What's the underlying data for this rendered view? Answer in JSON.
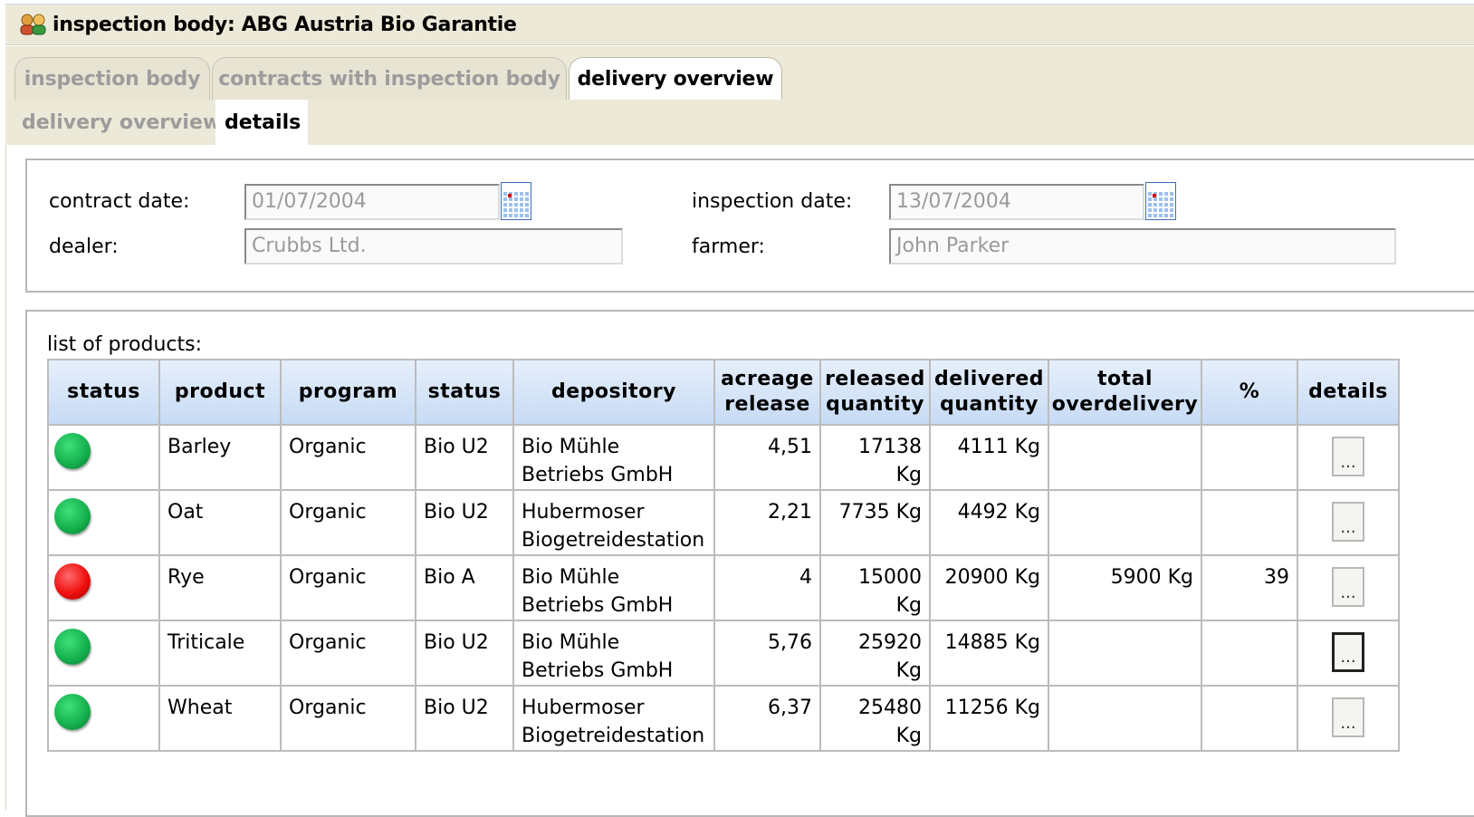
{
  "window": {
    "title": "inspection body: ABG Austria Bio Garantie",
    "icon": "users-icon"
  },
  "tabs": [
    {
      "label": "inspection body",
      "active": false
    },
    {
      "label": "contracts with inspection body",
      "active": false
    },
    {
      "label": "delivery overview",
      "active": true
    }
  ],
  "subtabs": [
    {
      "label": "delivery overview",
      "active": false
    },
    {
      "label": "details",
      "active": true
    }
  ],
  "form": {
    "contract_date_label": "contract date:",
    "contract_date_value": "01/07/2004",
    "inspection_date_label": "inspection date:",
    "inspection_date_value": "13/07/2004",
    "dealer_label": "dealer:",
    "dealer_value": "Crubbs Ltd.",
    "farmer_label": "farmer:",
    "farmer_value": "John Parker"
  },
  "products": {
    "caption": "list of products:",
    "headers": {
      "status": "status",
      "product": "product",
      "program": "program",
      "status2": "status",
      "depository": "depository",
      "acreage_line1": "acreage",
      "acreage_line2": "release",
      "released_line1": "released",
      "released_line2": "quantity",
      "delivered_line1": "delivered",
      "delivered_line2": "quantity",
      "overdelivery_line1": "total",
      "overdelivery_line2": "overdelivery",
      "percent": "%",
      "details": "details"
    },
    "rows": [
      {
        "status_color": "green",
        "product": "Barley",
        "program": "Organic",
        "status": "Bio U2",
        "depository_line1": "Bio Mühle",
        "depository_line2": "Betriebs GmbH",
        "acreage": "4,51",
        "released": "17138 Kg",
        "delivered": "4111 Kg",
        "overdelivery": "",
        "percent": "",
        "details_label": "...",
        "details_focused": false
      },
      {
        "status_color": "green",
        "product": "Oat",
        "program": "Organic",
        "status": "Bio U2",
        "depository_line1": "Hubermoser",
        "depository_line2": "Biogetreidestation",
        "acreage": "2,21",
        "released": "7735 Kg",
        "delivered": "4492 Kg",
        "overdelivery": "",
        "percent": "",
        "details_label": "...",
        "details_focused": false
      },
      {
        "status_color": "red",
        "product": "Rye",
        "program": "Organic",
        "status": "Bio A",
        "depository_line1": "Bio Mühle",
        "depository_line2": "Betriebs GmbH",
        "acreage": "4",
        "released": "15000 Kg",
        "delivered": "20900 Kg",
        "overdelivery": "5900 Kg",
        "percent": "39",
        "details_label": "...",
        "details_focused": false
      },
      {
        "status_color": "green",
        "product": "Triticale",
        "program": "Organic",
        "status": "Bio U2",
        "depository_line1": "Bio Mühle",
        "depository_line2": "Betriebs GmbH",
        "acreage": "5,76",
        "released": "25920 Kg",
        "delivered": "14885 Kg",
        "overdelivery": "",
        "percent": "",
        "details_label": "...",
        "details_focused": true
      },
      {
        "status_color": "green",
        "product": "Wheat",
        "program": "Organic",
        "status": "Bio U2",
        "depository_line1": "Hubermoser",
        "depository_line2": "Biogetreidestation",
        "acreage": "6,37",
        "released": "25480 Kg",
        "delivered": "11256 Kg",
        "overdelivery": "",
        "percent": "",
        "details_label": "...",
        "details_focused": false
      }
    ]
  }
}
